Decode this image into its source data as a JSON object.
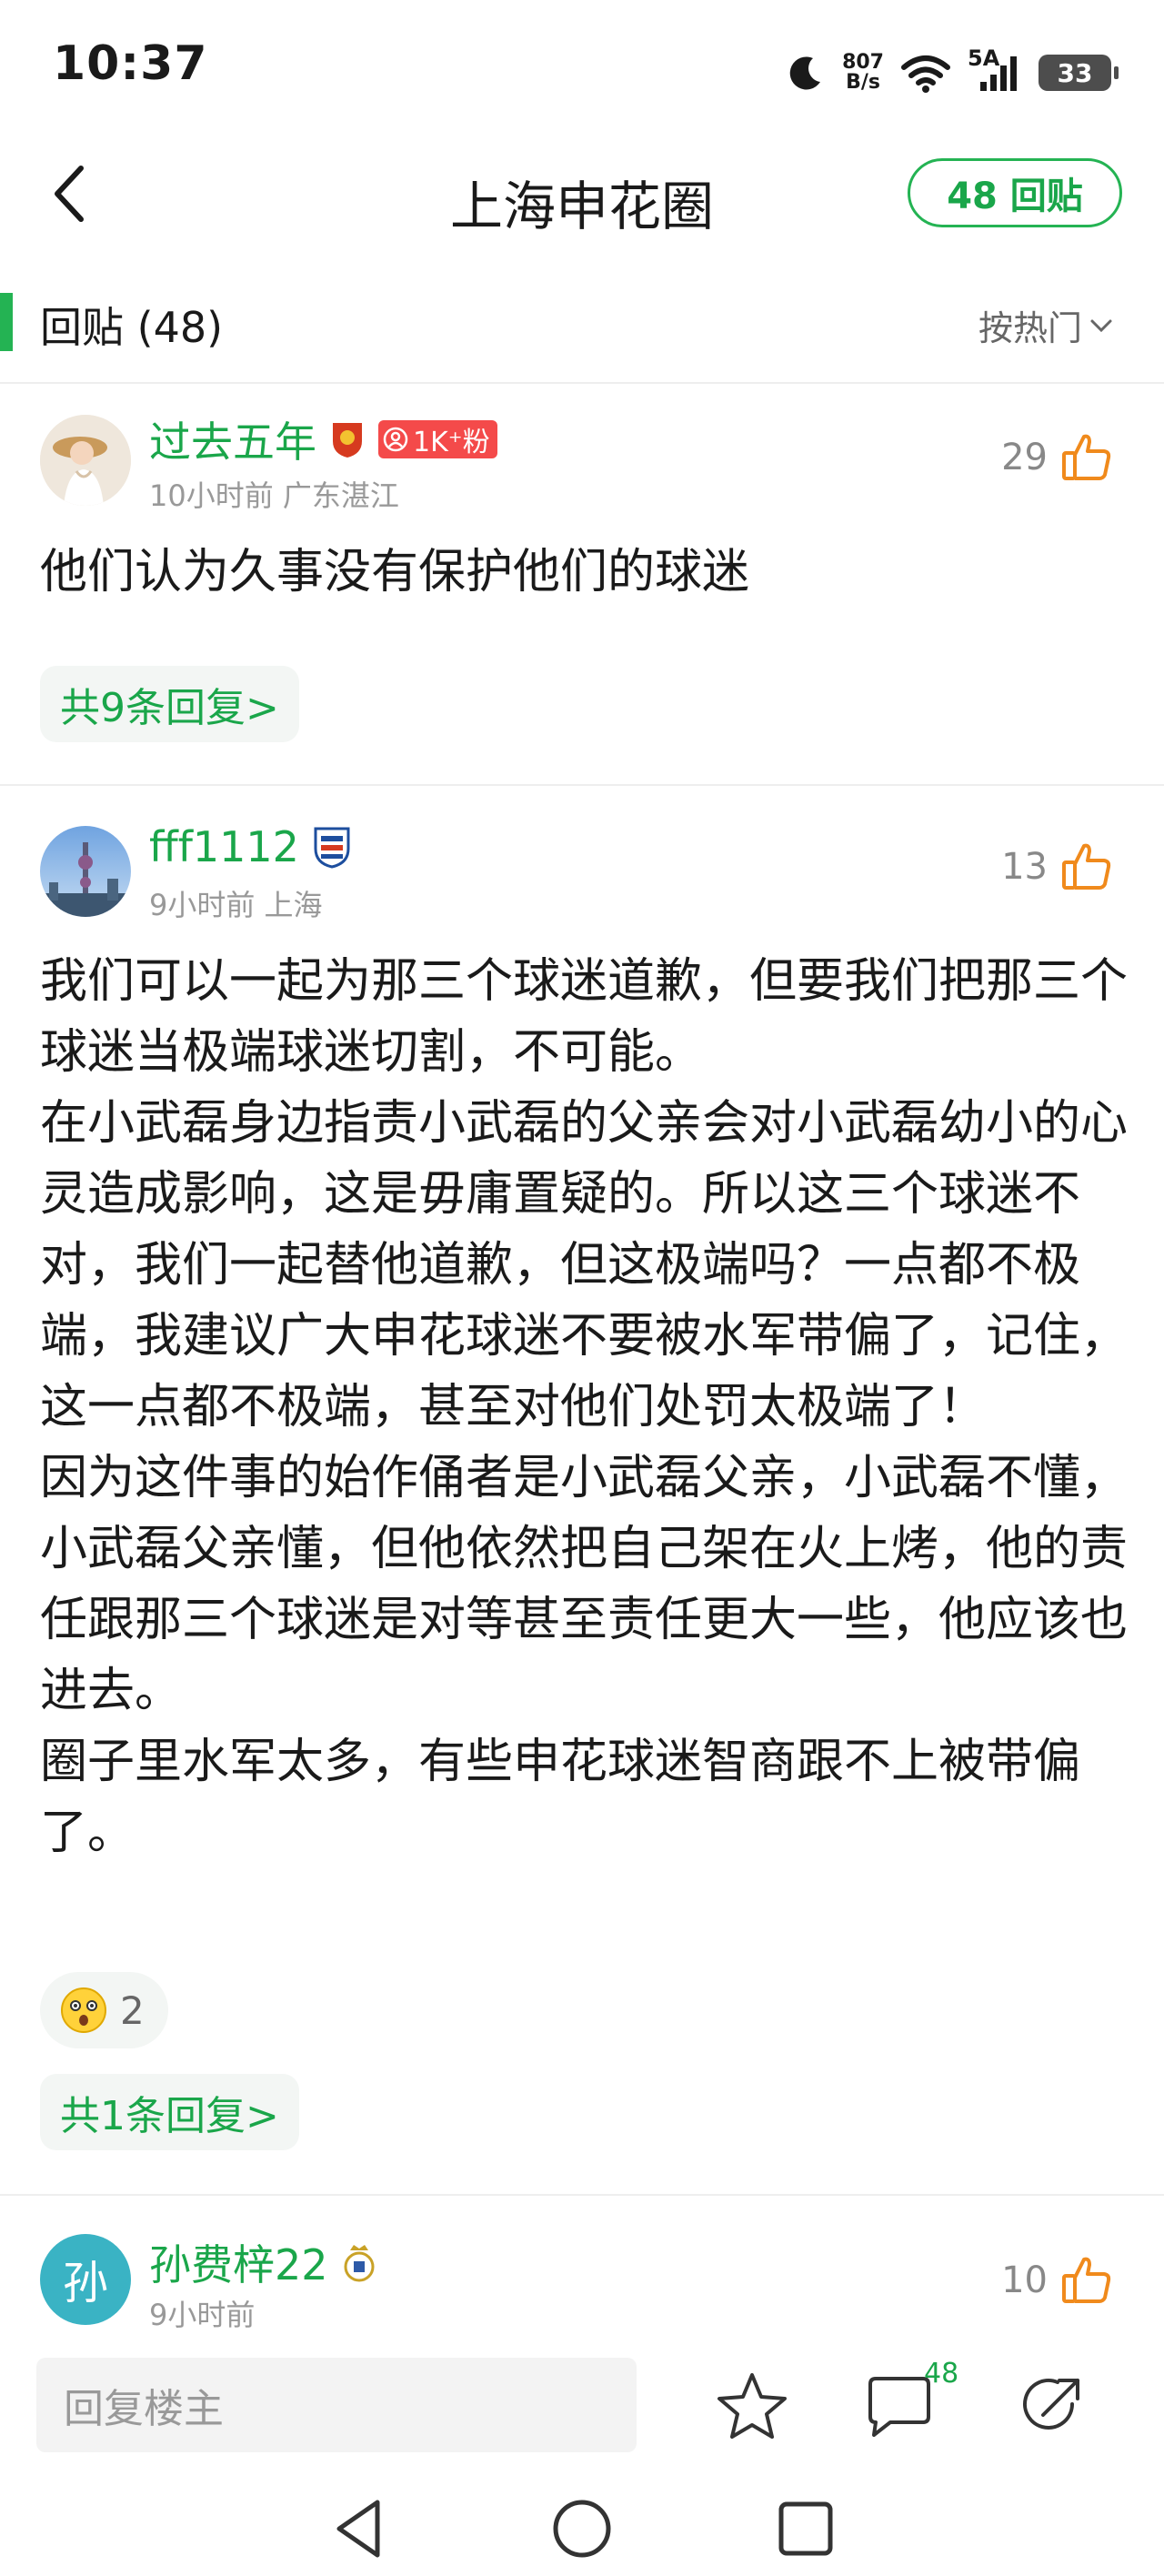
{
  "status_bar": {
    "time": "10:37",
    "speed_value": "807",
    "speed_unit": "B/s",
    "network": "5A",
    "battery": "33"
  },
  "header": {
    "title": "上海申花圈",
    "reply_count_label": "48 回贴"
  },
  "section": {
    "title": "回贴 (48)",
    "sort_label": "按热门"
  },
  "posts": [
    {
      "user": "过去五年",
      "fan_badge": "1K⁺粉",
      "meta": "10小时前 广东湛江",
      "likes": "29",
      "body": [
        "他们认为久事没有保护他们的球迷"
      ],
      "replies_label": "共9条回复>"
    },
    {
      "user": "fff1112",
      "meta": "9小时前 上海",
      "likes": "13",
      "body": [
        "我们可以一起为那三个球迷道歉，但要我们把那三个球迷当极端球迷切割，不可能。",
        "在小武磊身边指责小武磊的父亲会对小武磊幼小的心灵造成影响，这是毋庸置疑的。所以这三个球迷不对，我们一起替他道歉，但这极端吗？一点都不极端，我建议广大申花球迷不要被水军带偏了，记住，这一点都不极端，甚至对他们处罚太极端了！",
        "因为这件事的始作俑者是小武磊父亲，小武磊不懂，小武磊父亲懂，但他依然把自己架在火上烤，他的责任跟那三个球迷是对等甚至责任更大一些，他应该也进去。",
        "圈子里水军太多，有些申花球迷智商跟不上被带偏了。"
      ],
      "reaction_count": "2",
      "replies_label": "共1条回复>"
    },
    {
      "user": "孙费梓22",
      "avatar_char": "孙",
      "meta": "9小时前",
      "likes": "10"
    }
  ],
  "bottom_bar": {
    "reply_placeholder": "回复楼主",
    "comment_count": "48"
  },
  "colors": {
    "accent": "#24b353",
    "username": "#1aa64a",
    "like_icon": "#f08a1c",
    "fan_badge": "#f44a4a"
  }
}
